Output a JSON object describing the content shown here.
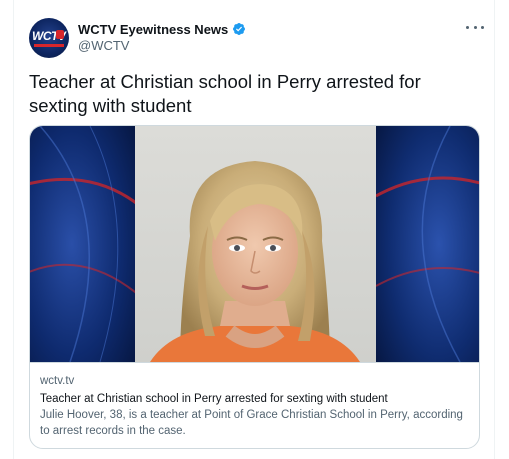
{
  "account": {
    "display_name": "WCTV Eyewitness News",
    "handle": "@WCTV",
    "verified": true,
    "avatar_logo_text": "WCTV",
    "avatar_icon": "wctv-logo"
  },
  "tweet": {
    "text": "Teacher at Christian school in Perry arrested for sexting with student"
  },
  "card": {
    "domain": "wctv.tv",
    "title": "Teacher at Christian school in Perry arrested for sexting with student",
    "description": "Julie Hoover, 38, is a teacher at Point of Grace Christian School in Perry, according to arrest records in the case.",
    "image_icon": "mugshot-photo"
  },
  "colors": {
    "brand_blue": "#1d9bf0",
    "text_primary": "#0f1419",
    "text_secondary": "#536471",
    "border": "#cfd9de",
    "background_blue": "#0b2a72",
    "accent_red": "#c8262b"
  }
}
